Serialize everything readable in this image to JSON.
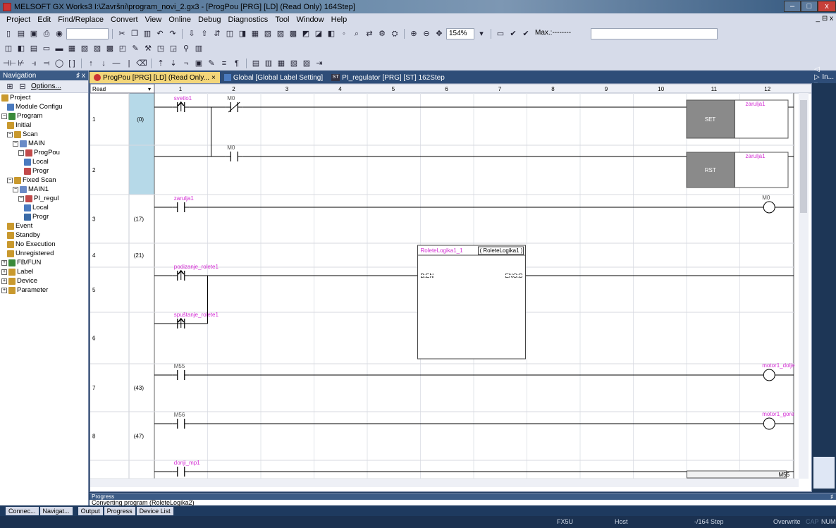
{
  "window": {
    "title": "MELSOFT GX Works3 I:\\Završni\\program_novi_2.gx3 - [ProgPou [PRG] [LD] (Read Only) 164Step]",
    "min": "–",
    "max": "□",
    "close": "x",
    "mdi": "_ ⊟ x"
  },
  "menu": [
    "Project",
    "Edit",
    "Find/Replace",
    "Convert",
    "View",
    "Online",
    "Debug",
    "Diagnostics",
    "Tool",
    "Window",
    "Help"
  ],
  "toolbar": {
    "zoom": "154%",
    "max_label": "Max.:--------"
  },
  "navigation": {
    "header": "Navigation",
    "pin": "♯ x",
    "tools_options": "Options...",
    "tree": [
      {
        "label": "Project",
        "level": 0,
        "pm": "",
        "color": "#c9992e"
      },
      {
        "label": "Module Configu",
        "level": 1,
        "pm": "",
        "color": "#4a7abf"
      },
      {
        "label": "Program",
        "level": 0,
        "pm": "−",
        "color": "#3a8a3a"
      },
      {
        "label": "Initial",
        "level": 1,
        "pm": "",
        "color": "#c9992e"
      },
      {
        "label": "Scan",
        "level": 1,
        "pm": "−",
        "color": "#c9992e"
      },
      {
        "label": "MAIN",
        "level": 2,
        "pm": "−",
        "color": "#6a8ac6"
      },
      {
        "label": "ProgPou",
        "level": 3,
        "pm": "−",
        "color": "#c24a4a"
      },
      {
        "label": "Local",
        "level": 4,
        "pm": "",
        "color": "#4a7abf"
      },
      {
        "label": "Progr",
        "level": 4,
        "pm": "",
        "color": "#c24a4a"
      },
      {
        "label": "Fixed Scan",
        "level": 1,
        "pm": "−",
        "color": "#c9992e"
      },
      {
        "label": "MAIN1",
        "level": 2,
        "pm": "−",
        "color": "#6a8ac6"
      },
      {
        "label": "PI_regul",
        "level": 3,
        "pm": "−",
        "color": "#c24a4a"
      },
      {
        "label": "Local",
        "level": 4,
        "pm": "",
        "color": "#4a7abf"
      },
      {
        "label": "Progr",
        "level": 4,
        "pm": "",
        "color": "#3a6aa6"
      },
      {
        "label": "Event",
        "level": 1,
        "pm": "",
        "color": "#c9992e"
      },
      {
        "label": "Standby",
        "level": 1,
        "pm": "",
        "color": "#c9992e"
      },
      {
        "label": "No Execution",
        "level": 1,
        "pm": "",
        "color": "#c9992e"
      },
      {
        "label": "Unregistered",
        "level": 1,
        "pm": "",
        "color": "#c9992e"
      },
      {
        "label": "FB/FUN",
        "level": 0,
        "pm": "+",
        "color": "#3a8a3a"
      },
      {
        "label": "Label",
        "level": 0,
        "pm": "+",
        "color": "#c9992e"
      },
      {
        "label": "Device",
        "level": 0,
        "pm": "+",
        "color": "#c9992e"
      },
      {
        "label": "Parameter",
        "level": 0,
        "pm": "+",
        "color": "#c9992e"
      }
    ]
  },
  "tabs": [
    {
      "label": "ProgPou [PRG] [LD] (Read Only...",
      "close": "×",
      "active": true
    },
    {
      "label": "Global [Global Label Setting]",
      "close": "",
      "active": false
    },
    {
      "label": "PI_regulator [PRG] [ST] 162Step",
      "close": "",
      "active": false
    }
  ],
  "right_panel": {
    "label": "In...",
    "nav": "◁ ▷ ▾",
    "pin": "♯"
  },
  "ladder": {
    "mode": "Read",
    "columns": [
      "1",
      "2",
      "3",
      "4",
      "5",
      "6",
      "7",
      "8",
      "9",
      "10",
      "11",
      "12"
    ],
    "rows": [
      {
        "num": "1",
        "step": "(0)"
      },
      {
        "num": "2",
        "step": ""
      },
      {
        "num": "3",
        "step": "(17)"
      },
      {
        "num": "4",
        "step": "(21)"
      },
      {
        "num": "5",
        "step": ""
      },
      {
        "num": "6",
        "step": ""
      },
      {
        "num": "7",
        "step": "(43)"
      },
      {
        "num": "8",
        "step": "(47)"
      },
      {
        "num": "",
        "step": ""
      }
    ],
    "contacts": [
      {
        "label": "svetlo1",
        "row": 0,
        "col": 0,
        "type": "rise",
        "color": "#d42fd4"
      },
      {
        "label": "M0",
        "row": 0,
        "col": 1,
        "type": "nc",
        "color": "#555"
      },
      {
        "label": "M0",
        "row": 1,
        "col": 1,
        "type": "no",
        "color": "#555"
      },
      {
        "label": "zarulja1",
        "row": 2,
        "col": 0,
        "type": "no",
        "color": "#d42fd4"
      },
      {
        "label": "podizanje_rolete1",
        "row": 4,
        "col": 0,
        "type": "rise",
        "color": "#d42fd4"
      },
      {
        "label": "spuštanje_rolete1",
        "row": 5,
        "col": 0,
        "type": "rise",
        "color": "#d42fd4"
      },
      {
        "label": "M55",
        "row": 6,
        "col": 0,
        "type": "no",
        "color": "#555"
      },
      {
        "label": "M56",
        "row": 7,
        "col": 0,
        "type": "no",
        "color": "#555"
      },
      {
        "label": "donji_mp1",
        "row": 8,
        "col": 0,
        "type": "no",
        "color": "#d42fd4"
      }
    ],
    "set_label": "SET",
    "rst_label": "RST",
    "set_target": "zarulja1",
    "rst_target": "zarulja1",
    "coils": [
      {
        "label": "M0",
        "row": 2,
        "color": "#555"
      },
      {
        "label": "motor1_dolje",
        "row": 6,
        "color": "#d42fd4"
      },
      {
        "label": "motor1_gore",
        "row": 7,
        "color": "#d42fd4"
      }
    ],
    "fb": {
      "instance": "RoleteLogika1_1",
      "type": "( RoleteLogika1 )",
      "input": "B:EN",
      "output": "ENO:B"
    },
    "bottom_right": "M55"
  },
  "progress": {
    "title": "Progress",
    "pin": "♯",
    "text": "Converting program (RoleteLogika2)"
  },
  "bottom_tabs": [
    "Connec...",
    "Navigat...",
    "Output",
    "Progress",
    "Device List"
  ],
  "status": [
    "FX5U",
    "Host",
    "-/164 Step",
    "Overwrite",
    "CAP",
    "NUM"
  ]
}
